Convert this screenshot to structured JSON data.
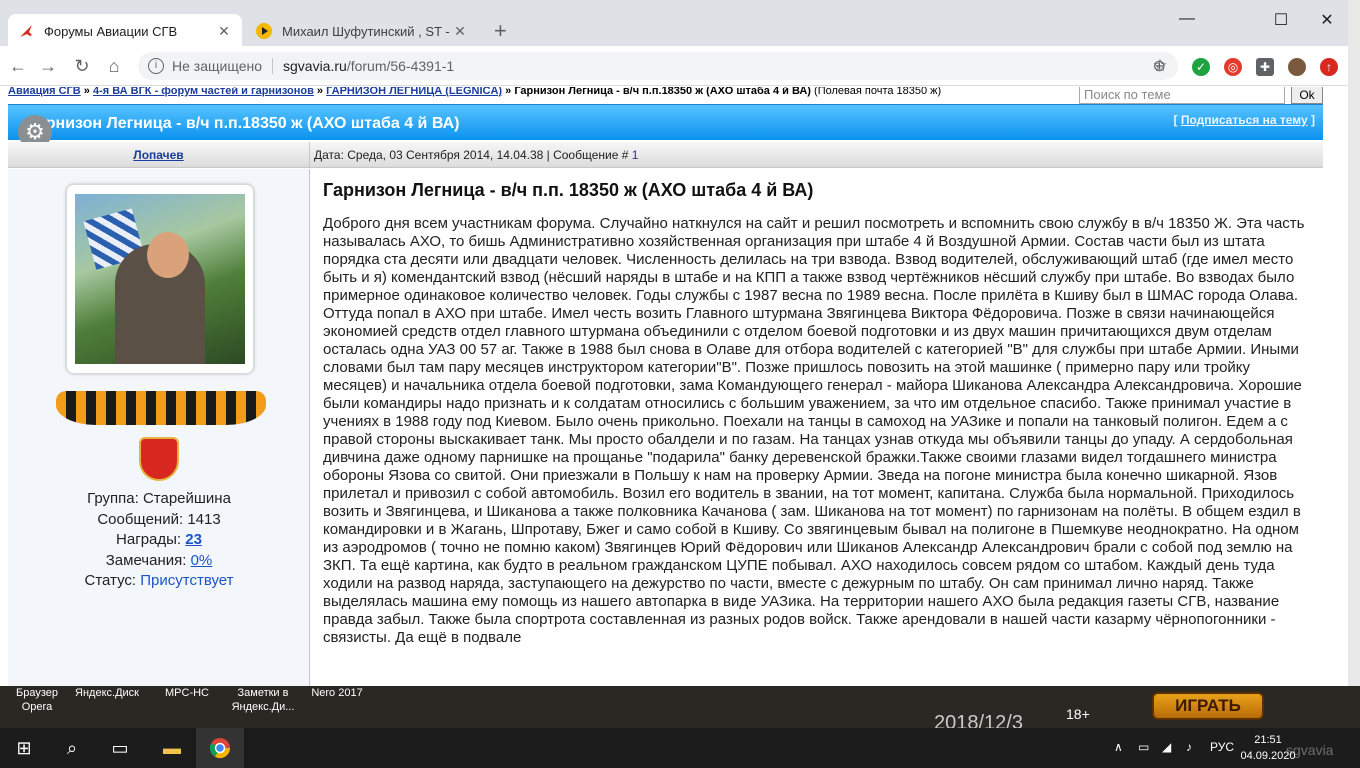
{
  "browser": {
    "tabs": [
      {
        "title": "Форумы Авиации СГВ",
        "active": true
      },
      {
        "title": "Михаил Шуфутинский , ST - Сча",
        "active": false
      }
    ],
    "new_tab": "+",
    "window_controls": {
      "minimize": "—",
      "maximize": "☐",
      "close": "✕"
    },
    "security_label": "Не защищено",
    "url_host": "sgvavia.ru",
    "url_path": "/forum/56-4391-1"
  },
  "breadcrumb": {
    "items": [
      "Авиация СГВ",
      "4-я ВА ВГК - форум частей и гарнизонов",
      "ГАРНИЗОН ЛЕГНИЦА (LEGNICA)"
    ],
    "separator": "»",
    "current": "Гарнизон Легница - в/ч п.п.18350 ж (АХО штаба 4 й ВА)",
    "note": "(Полевая почта 18350 ж)"
  },
  "search": {
    "placeholder": "Поиск по теме",
    "button": "Ok"
  },
  "topic": {
    "title": "Гарнизон Легница - в/ч п.п.18350 ж (АХО штаба 4 й ВА)",
    "subscribe_open": "[",
    "subscribe": "Подписаться на тему",
    "subscribe_close": "]"
  },
  "post": {
    "author": "Лопачев",
    "date_label": "Дата: Среда, 03 Сентября 2014, 14.04.38 | Сообщение #",
    "post_number": "1",
    "group_label": "Группа: Старейшина",
    "messages_label": "Сообщений: 1413",
    "awards_label": "Награды:",
    "awards_value": "23",
    "remarks_label": "Замечания:",
    "remarks_value": "0%",
    "status_label": "Статус:",
    "status_value": "Присутствует",
    "title": "Гарнизон Легница - в/ч п.п. 18350 ж (АХО штаба 4 й ВА)",
    "text": "Доброго дня всем участникам форума. Случайно наткнулся на сайт и решил посмотреть и вспомнить свою службу в в/ч 18350 Ж. Эта часть называлась АХО, то бишь Административно хозяйственная организация при штабе 4 й Воздушной Армии. Состав части был из штата порядка ста десяти или двадцати человек. Численность делилась на три взвода. Взвод водителей, обслуживающий штаб (где имел место быть и я) комендантский взвод (нёсший наряды в штабе и на КПП а также взвод чертёжников нёсший службу при штабе. Во взводах было примерное одинаковое количество человек. Годы службы с 1987 весна по 1989 весна. После прилёта в Кшиву был в ШМАС города Олава. Оттуда попал в АХО при штабе. Имел честь возить Главного штурмана Звягинцева Виктора Фёдоровича. Позже в связи начинающейся экономией средств отдел главного штурмана объединили с отделом боевой подготовки и из двух машин причитающихся двум отделам осталась одна УАЗ 00 57 аг. Также в 1988 был снова в Олаве для отбора водителей с категорией \"В\" для службы при штабе Армии. Иными словами был там пару месяцев инструктором категории\"В\". Позже пришлось повозить на этой машинке ( примерно пару или тройку месяцев) и начальника отдела боевой подготовки, зама Командующего генерал - майора Шиканова Александра Александровича. Хорошие были командиры надо признать и к солдатам относились с большим уважением, за что им отдельное спасибо. Также принимал участие в учениях в 1988 году под Киевом. Было очень прикольно. Поехали на танцы в самоход на УАЗике и попали на танковый полигон. Едем а с правой стороны выскакивает танк. Мы просто обалдели и по газам. На танцах узнав откуда мы объявили танцы до упаду. А сердобольная дивчина даже одному парнишке на прощанье \"подарила\" банку деревенской бражки.Также своими глазами видел тогдашнего министра обороны Язова со свитой. Они приезжали в Польшу к нам на проверку Армии. Зведа на погоне министра была конечно шикарной. Язов прилетал и привозил с собой автомобиль. Возил его водитель в звании, на тот момент, капитана. Служба была нормальной. Приходилось возить и Звягинцева, и Шиканова а также полковника Качанова ( зам. Шиканова на тот момент) по гарнизонам на полёты. В общем ездил в командировки и в Жагань, Шпротаву, Бжег и само собой в Кшиву. Со звягинцевым бывал на полигоне в Пшемкуве неоднократно. На одном из аэродромов ( точно не помню каком) Звягинцев Юрий Фёдорович или Шиканов Александр Александрович брали с собой под землю на ЗКП. Та ещё картина, как будто в реальном гражданском ЦУПЕ побывал. АХО находилось совсем рядом со штабом. Каждый день туда ходили на развод наряда, заступающего на дежурство по части, вместе с дежурным по штабу. Он сам принимал лично наряд. Также выделялась машина ему помощь из нашего автопарка в виде УАЗика. На территории нашего АХО была редакция газеты СГВ, название правда забыл. Также была спортрота составленная из разных родов войск. Также арендовали в нашей части казарму чёрнопогонники - связисты. Да ещё в подвале"
  },
  "desktop": {
    "icons": [
      "Браузер Opera",
      "Яндекс.Диск",
      "MPC-HC",
      "Заметки в Яндекс.Ди...",
      "Nero 2017"
    ],
    "play_button": "ИГРАТЬ",
    "age_badge": "18+",
    "date_stamp": "2018/12/3"
  },
  "taskbar": {
    "language": "РУС",
    "time": "21:51",
    "date": "04.09.2020",
    "watermark": "sgvavia"
  }
}
